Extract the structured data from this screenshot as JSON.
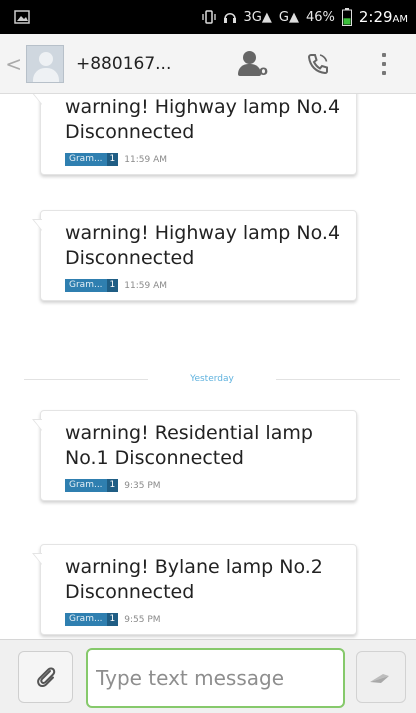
{
  "status_bar": {
    "network": "3G",
    "network2": "G",
    "battery": "46%",
    "time": "2:29",
    "ampm": "AM",
    "battery_color": "#3cbf3c"
  },
  "action_bar": {
    "back_glyph": "<",
    "contact": "+880167..."
  },
  "messages": [
    {
      "text": "warning! Highway lamp No.4 Disconnected",
      "sim": "Gram...",
      "sim_num": "1",
      "time": "11:59 AM"
    },
    {
      "text": "warning! Highway lamp No.4 Disconnected",
      "sim": "Gram...",
      "sim_num": "1",
      "time": "11:59 AM"
    },
    {
      "text": "warning! Residential lamp No.1 Disconnected",
      "sim": "Gram...",
      "sim_num": "1",
      "time": "9:35 PM"
    },
    {
      "text": "warning! Bylane lamp No.2 Disconnected",
      "sim": "Gram...",
      "sim_num": "1",
      "time": "9:55 PM"
    }
  ],
  "divider": {
    "label": "Yesterday"
  },
  "compose": {
    "placeholder": "Type text message"
  },
  "colors": {
    "accent_green": "#86c96b",
    "sim_blue": "#2f7fb0",
    "divider_blue": "#5fb2de"
  }
}
